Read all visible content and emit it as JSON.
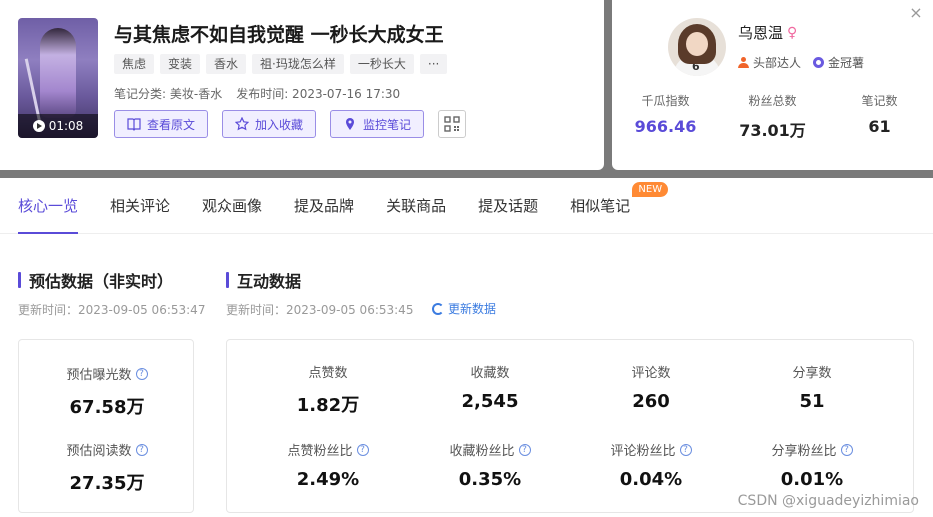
{
  "note": {
    "duration": "01:08",
    "title": "与其焦虑不如自我觉醒 一秒长大成女王",
    "tags": [
      "焦虑",
      "变装",
      "香水",
      "祖·玛珑怎么样",
      "一秒长大",
      "···"
    ],
    "category": "笔记分类: 美妆-香水",
    "publish_time": "发布时间: 2023-07-16 17:30",
    "actions": {
      "view_original": "查看原文",
      "add_favorite": "加入收藏",
      "monitor_note": "监控笔记"
    }
  },
  "author": {
    "name": "乌恩温",
    "badge_top": "头部达人",
    "badge_crown": "金冠薯",
    "stats": [
      {
        "label": "千瓜指数",
        "value": "966.46"
      },
      {
        "label": "粉丝总数",
        "value": "73.01万"
      },
      {
        "label": "笔记数",
        "value": "61"
      }
    ]
  },
  "tabs": [
    "核心一览",
    "相关评论",
    "观众画像",
    "提及品牌",
    "关联商品",
    "提及话题",
    "相似笔记"
  ],
  "new_badge": "NEW",
  "estimated": {
    "title": "预估数据（非实时）",
    "updated": "更新时间：2023-09-05 06:53:47",
    "metrics": [
      {
        "label": "预估曝光数",
        "value": "67.58万"
      },
      {
        "label": "预估阅读数",
        "value": "27.35万"
      }
    ]
  },
  "interaction": {
    "title": "互动数据",
    "updated": "更新时间：2023-09-05 06:53:45",
    "refresh": "更新数据",
    "metrics": [
      {
        "label": "点赞数",
        "value": "1.82万"
      },
      {
        "label": "收藏数",
        "value": "2,545"
      },
      {
        "label": "评论数",
        "value": "260"
      },
      {
        "label": "分享数",
        "value": "51"
      },
      {
        "label": "点赞粉丝比",
        "value": "2.49%"
      },
      {
        "label": "收藏粉丝比",
        "value": "0.35%"
      },
      {
        "label": "评论粉丝比",
        "value": "0.04%"
      },
      {
        "label": "分享粉丝比",
        "value": "0.01%"
      }
    ]
  },
  "watermark": "CSDN @xiguadeyizhimiao",
  "colors": {
    "accent": "#5a4bd8",
    "new_badge": "#ff8a34",
    "link": "#3a7be0"
  }
}
